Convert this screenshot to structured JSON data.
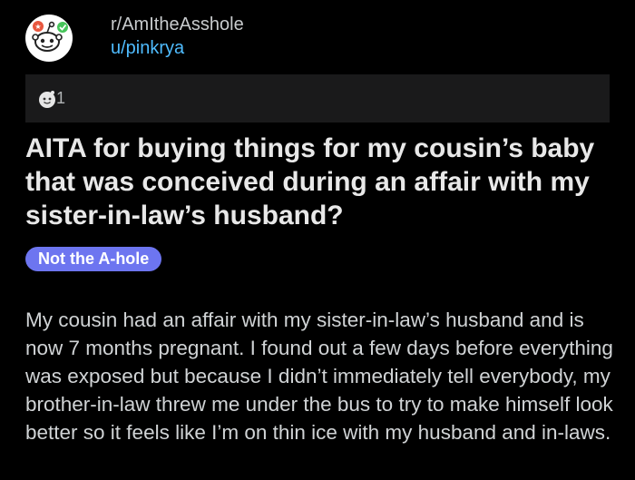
{
  "post": {
    "subreddit": "r/AmItheAsshole",
    "username": "u/pinkrya",
    "awards": {
      "icon": "wholesome-award-icon",
      "count": "1"
    },
    "title": "AITA for buying things for my cousin’s baby that was conceived during an affair with my sister-in-law’s husband?",
    "flair": "Not the A-hole",
    "body": "My cousin had an affair with my sister-in-law’s husband and is now 7 months pregnant. I found out a few days before everything was exposed but because I didn’t immediately tell everybody, my brother-in-law threw me under the bus to try to make himself look better so it feels like I’m on thin ice with my husband and in-laws."
  },
  "colors": {
    "background": "#000000",
    "award_bar": "#1a1a1b",
    "username": "#4fbcff",
    "flair_bg": "#6d75f0"
  }
}
